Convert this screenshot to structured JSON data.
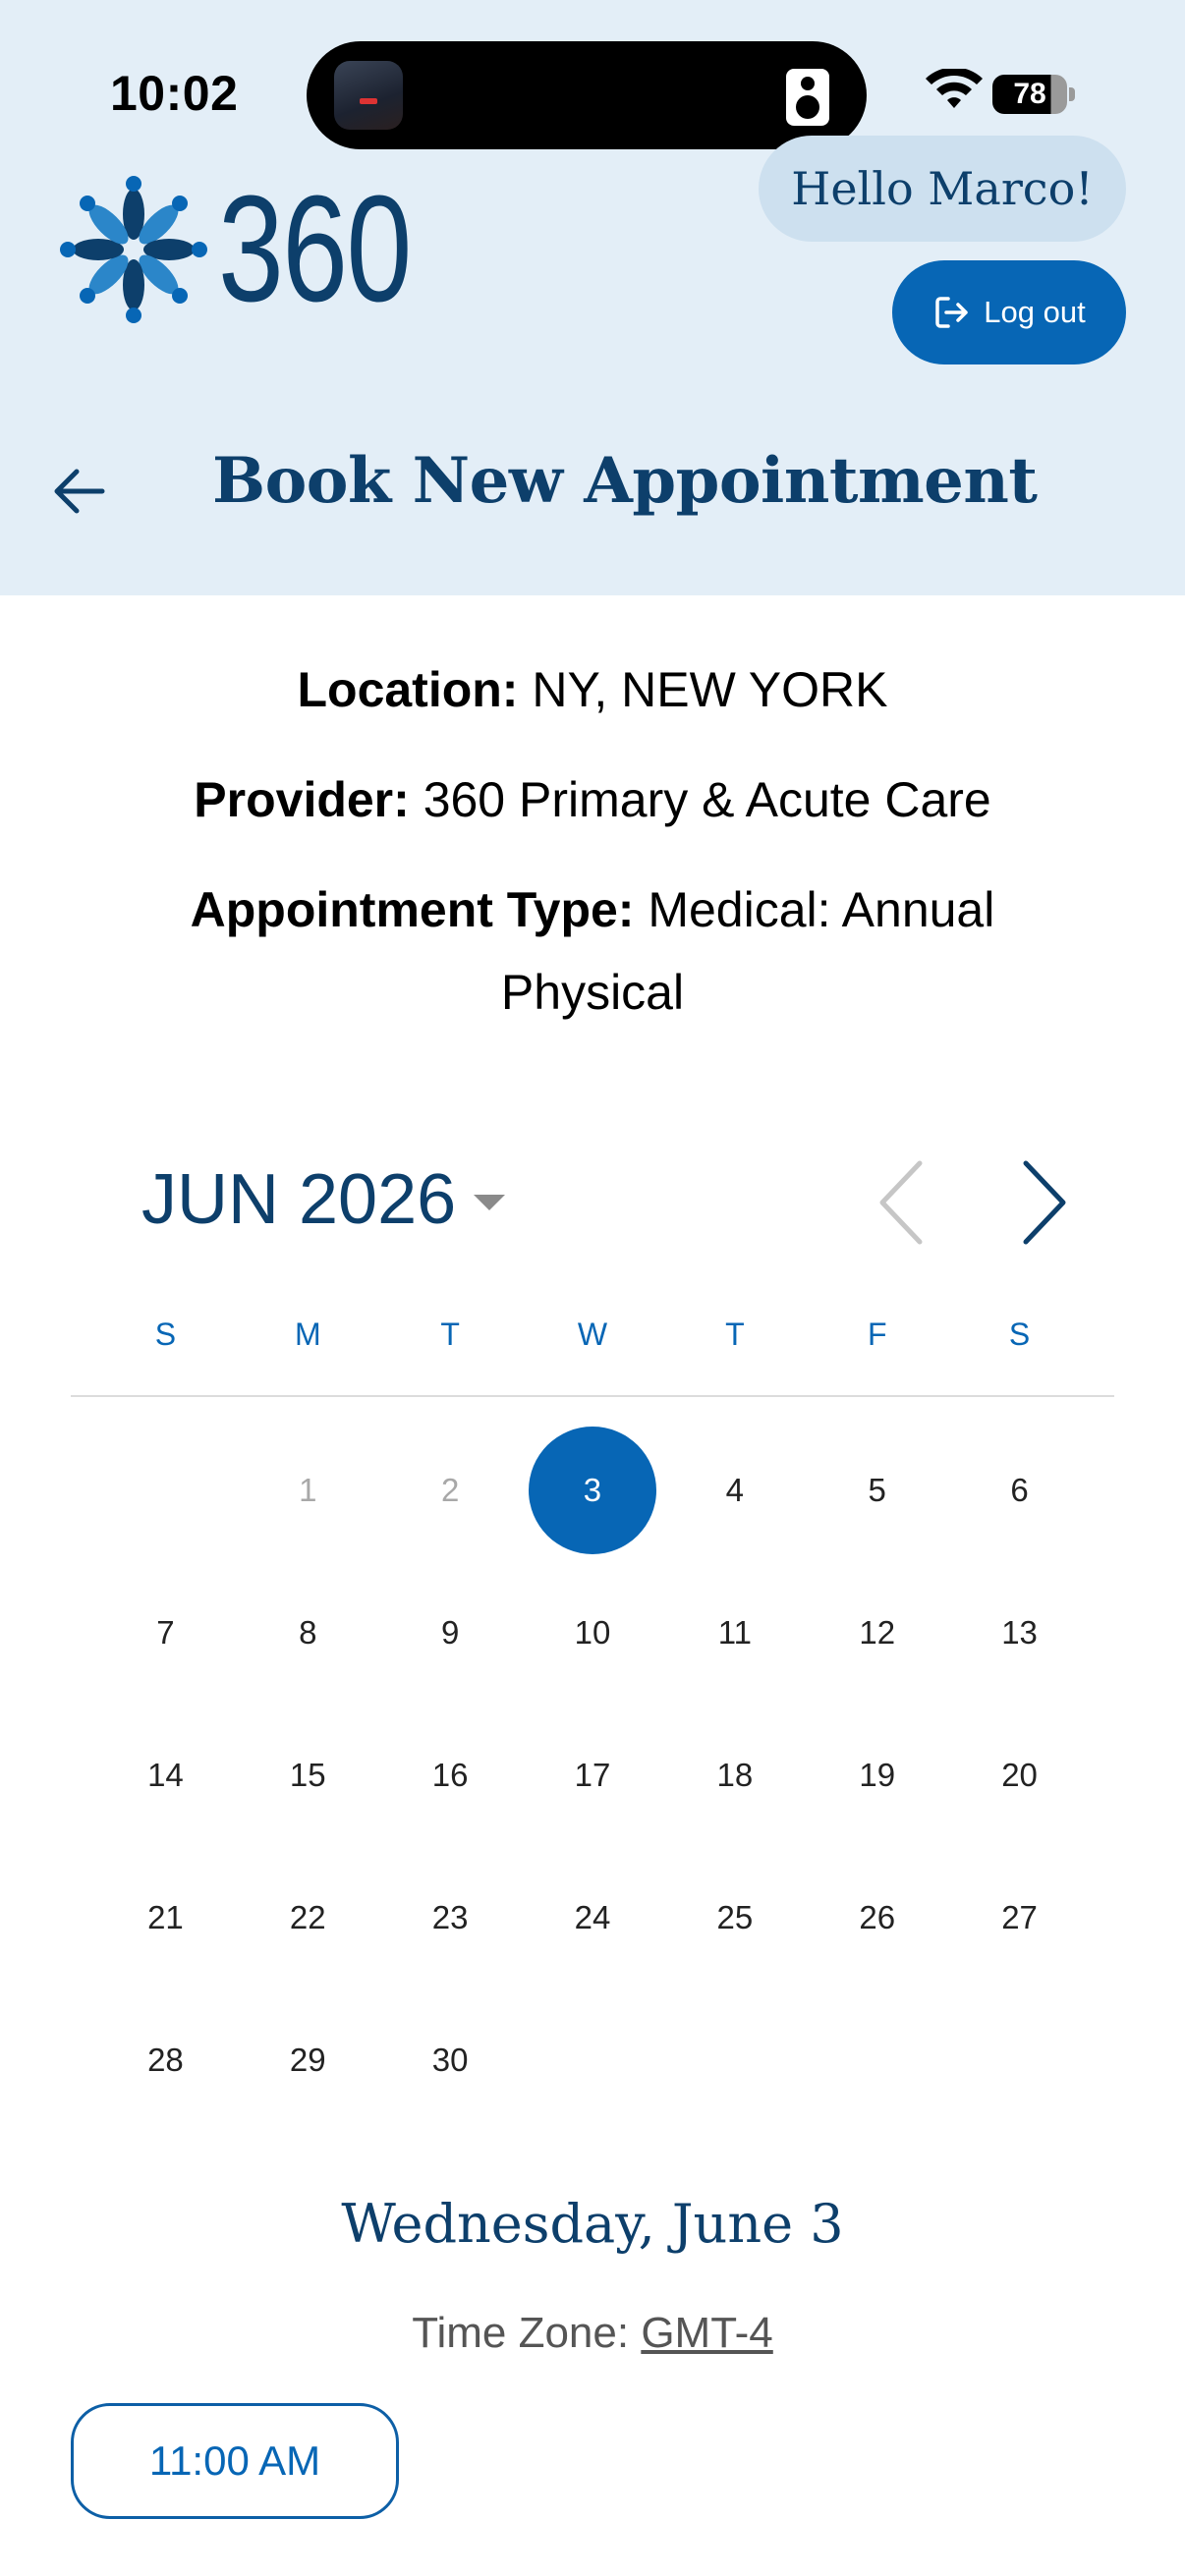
{
  "status_bar": {
    "time": "10:02",
    "battery": "78"
  },
  "header": {
    "logo_text": "360",
    "greeting": "Hello Marco!",
    "logout_label": "Log out",
    "title": "Book New Appointment"
  },
  "info": {
    "location_label": "Location:",
    "location_value": " NY, NEW YORK",
    "provider_label": "Provider:",
    "provider_value": " 360 Primary & Acute Care",
    "type_label": "Appointment Type:",
    "type_value": " Medical: Annual Physical"
  },
  "calendar": {
    "month_label": "JUN 2026",
    "weekdays": [
      "S",
      "M",
      "T",
      "W",
      "T",
      "F",
      "S"
    ],
    "days": [
      "",
      "1",
      "2",
      "3",
      "4",
      "5",
      "6",
      "7",
      "8",
      "9",
      "10",
      "11",
      "12",
      "13",
      "14",
      "15",
      "16",
      "17",
      "18",
      "19",
      "20",
      "21",
      "22",
      "23",
      "24",
      "25",
      "26",
      "27",
      "28",
      "29",
      "30"
    ],
    "disabled_days": [
      "1",
      "2"
    ],
    "selected_day": "3"
  },
  "selection": {
    "date_heading": "Wednesday, June 3",
    "timezone_label": "Time Zone: ",
    "timezone_value": "GMT-4",
    "time_slots": [
      "11:00 AM"
    ]
  },
  "colors": {
    "primary": "#0766b5",
    "navy": "#0d3f6b",
    "header_bg": "#e3eef7"
  }
}
